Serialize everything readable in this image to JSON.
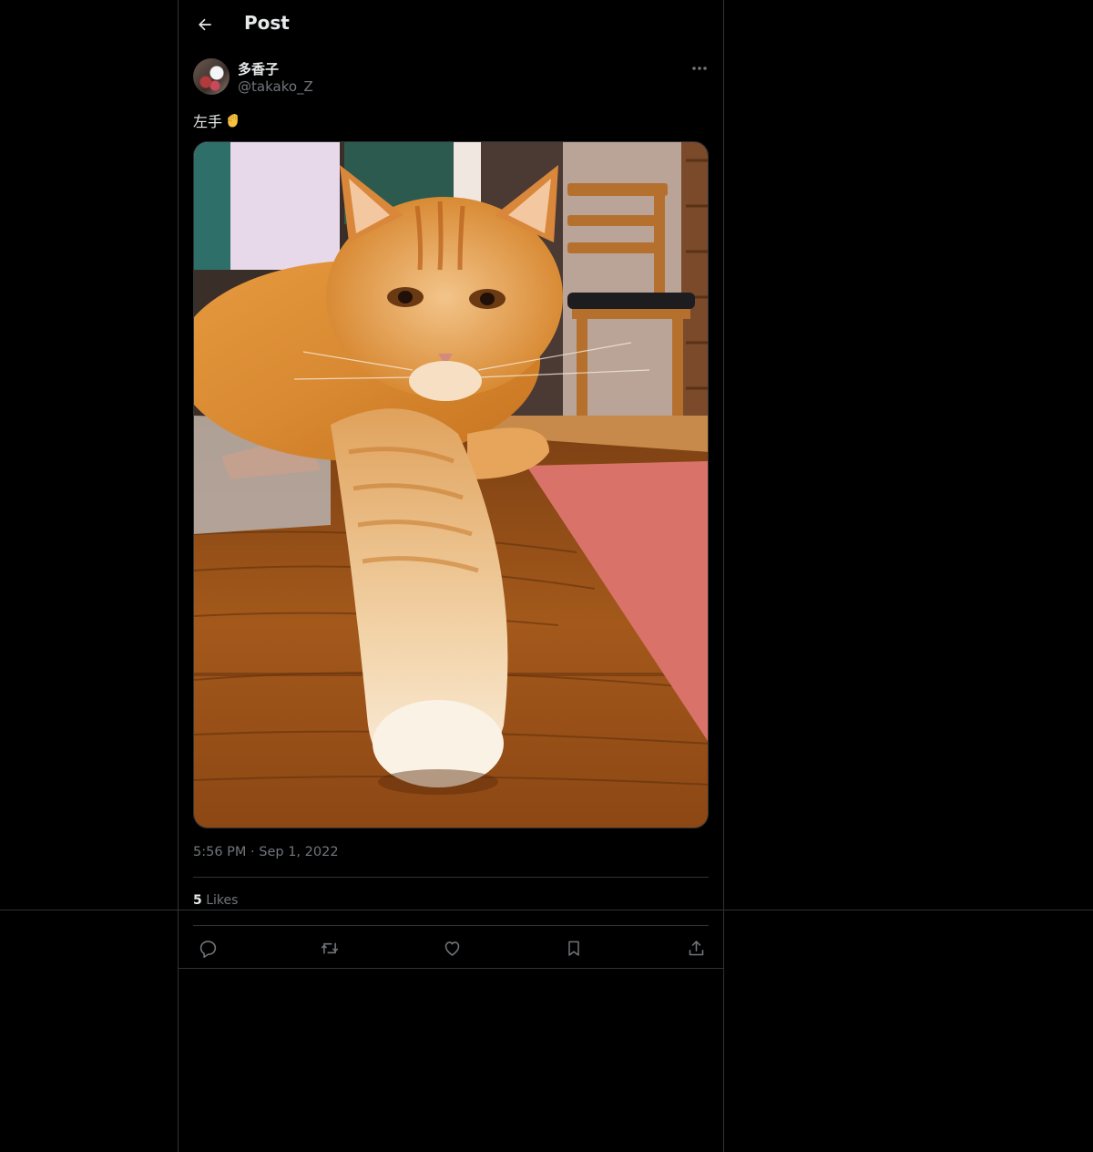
{
  "header": {
    "title": "Post",
    "back_icon": "arrow-left-icon"
  },
  "author": {
    "display_name": "多香子",
    "handle": "@takako_Z",
    "avatar": "avatar-image"
  },
  "post": {
    "text": "左手",
    "emoji_icon": "raised-fist-icon",
    "media_description_icon": "cat-photo",
    "time": "5:56 PM",
    "separator": "·",
    "date": "Sep 1, 2022"
  },
  "stats": {
    "likes_count": "5",
    "likes_label": "Likes"
  },
  "actions": [
    {
      "name": "reply",
      "icon": "reply-icon"
    },
    {
      "name": "repost",
      "icon": "repost-icon"
    },
    {
      "name": "like",
      "icon": "heart-icon"
    },
    {
      "name": "bookmark",
      "icon": "bookmark-icon"
    },
    {
      "name": "share",
      "icon": "share-icon"
    }
  ],
  "colors": {
    "background": "#000000",
    "border": "#2f3336",
    "text_primary": "#e7e9ea",
    "text_secondary": "#71767b"
  }
}
